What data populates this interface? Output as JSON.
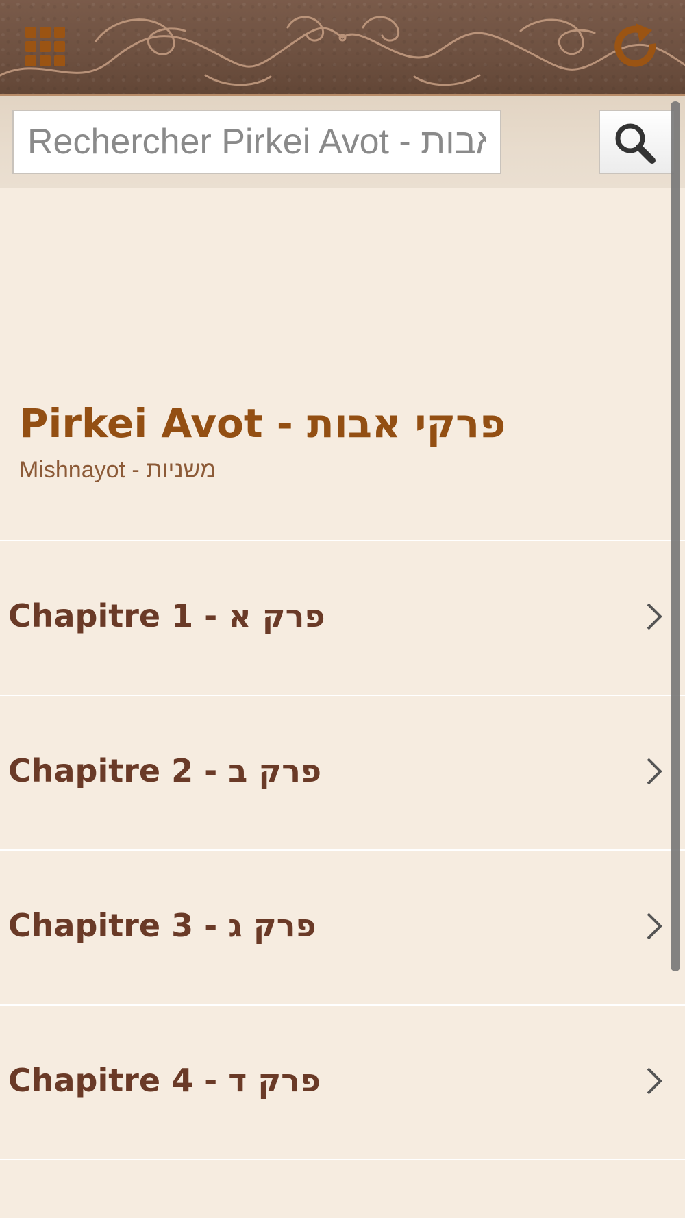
{
  "header": {
    "apps_icon": "apps-grid-icon",
    "refresh_icon": "refresh-icon",
    "colors": {
      "bar": "#6e5141",
      "icon_accent": "#9b5413"
    }
  },
  "search": {
    "placeholder": "Rechercher Pirkei Avot - פרקי אבות",
    "value": "",
    "button_icon": "search-icon"
  },
  "book": {
    "title": "Pirkei Avot - פרקי אבות",
    "subtitle": "Mishnayot - משניות",
    "title_color": "#934f13"
  },
  "chapters": [
    {
      "label": "Chapitre 1 - פרק א"
    },
    {
      "label": "Chapitre 2 - פרק ב"
    },
    {
      "label": "Chapitre 3 - פרק ג"
    },
    {
      "label": "Chapitre 4 - פרק ד"
    }
  ],
  "list_item_icon": "chevron-right-icon",
  "colors": {
    "background": "#f6ece0",
    "chapter_text": "#6a3a27",
    "divider": "#ffffff"
  }
}
